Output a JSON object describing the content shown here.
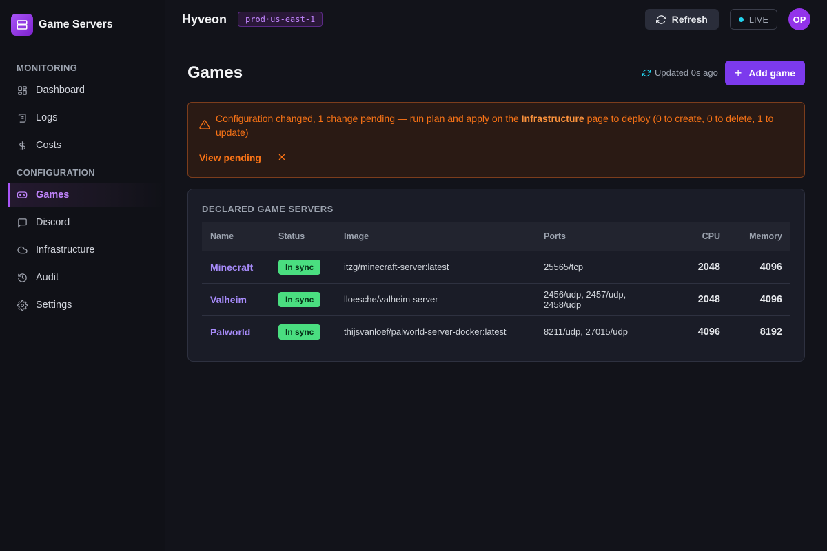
{
  "sidebar": {
    "brand": "Game Servers",
    "sections": [
      {
        "title": "MONITORING",
        "items": [
          {
            "label": "Dashboard",
            "icon": "dashboard-icon"
          },
          {
            "label": "Logs",
            "icon": "logs-icon"
          },
          {
            "label": "Costs",
            "icon": "dollar-icon"
          }
        ]
      },
      {
        "title": "CONFIGURATION",
        "items": [
          {
            "label": "Games",
            "icon": "gamepad-icon",
            "active": true
          },
          {
            "label": "Discord",
            "icon": "chat-icon"
          },
          {
            "label": "Infrastructure",
            "icon": "cloud-icon"
          },
          {
            "label": "Audit",
            "icon": "history-icon"
          },
          {
            "label": "Settings",
            "icon": "gear-icon"
          }
        ]
      }
    ]
  },
  "header": {
    "project": "Hyveon",
    "env": "prod·us-east-1",
    "refresh_label": "Refresh",
    "live_label": "LIVE",
    "avatar_initials": "OP"
  },
  "main": {
    "title": "Games",
    "updated": "Updated 0s ago",
    "add_label": "Add game",
    "alert": {
      "text_before": "Configuration changed, 1 change pending — run plan and apply on the ",
      "link": "Infrastructure",
      "text_after": " page to deploy (0 to create, 0 to delete, 1 to update)",
      "action": "View pending"
    },
    "table": {
      "title": "DECLARED GAME SERVERS",
      "columns": [
        "Name",
        "Status",
        "Image",
        "Ports",
        "CPU",
        "Memory"
      ],
      "rows": [
        {
          "name": "Minecraft",
          "status": "In sync",
          "image": "itzg/minecraft-server:latest",
          "ports": "25565/tcp",
          "cpu": "2048",
          "memory": "4096"
        },
        {
          "name": "Valheim",
          "status": "In sync",
          "image": "lloesche/valheim-server",
          "ports": "2456/udp, 2457/udp, 2458/udp",
          "cpu": "2048",
          "memory": "4096"
        },
        {
          "name": "Palworld",
          "status": "In sync",
          "image": "thijsvanloef/palworld-server-docker:latest",
          "ports": "8211/udp, 27015/udp",
          "cpu": "4096",
          "memory": "8192"
        }
      ]
    }
  },
  "colors": {
    "accent": "#7c3aed",
    "warning": "#f97316",
    "success": "#4ade80",
    "live": "#22d3ee"
  }
}
